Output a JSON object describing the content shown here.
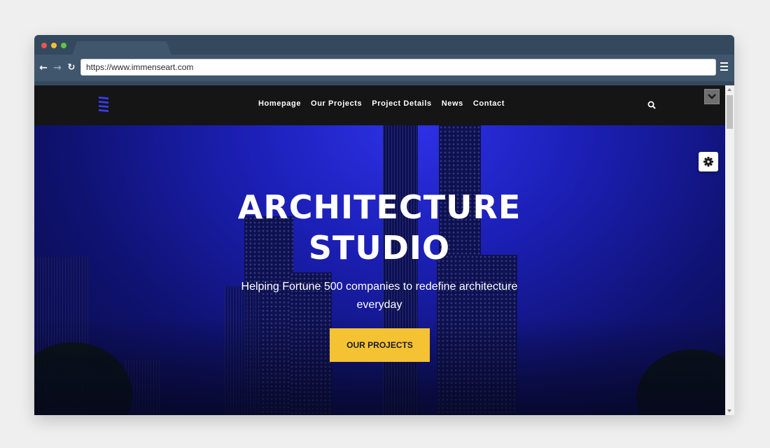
{
  "browser": {
    "url": "https://www.immenseart.com"
  },
  "site": {
    "nav": [
      "Homepage",
      "Our Projects",
      "Project Details",
      "News",
      "Contact"
    ]
  },
  "hero": {
    "title_line1": "ARCHITECTURE",
    "title_line2": "STUDIO",
    "subtitle": "Helping Fortune 500 companies to redefine architecture everyday",
    "cta_label": "OUR PROJECTS"
  },
  "colors": {
    "browser_chrome": "#34495e",
    "site_header": "#151515",
    "hero_blue": "#1c20b8",
    "logo_accent": "#3a3df0",
    "cta_yellow": "#f4c233"
  },
  "icons": [
    "back-arrow-icon",
    "forward-arrow-icon",
    "reload-icon",
    "hamburger-menu-icon",
    "logo-icon",
    "search-icon",
    "chevron-down-icon",
    "gear-icon"
  ]
}
